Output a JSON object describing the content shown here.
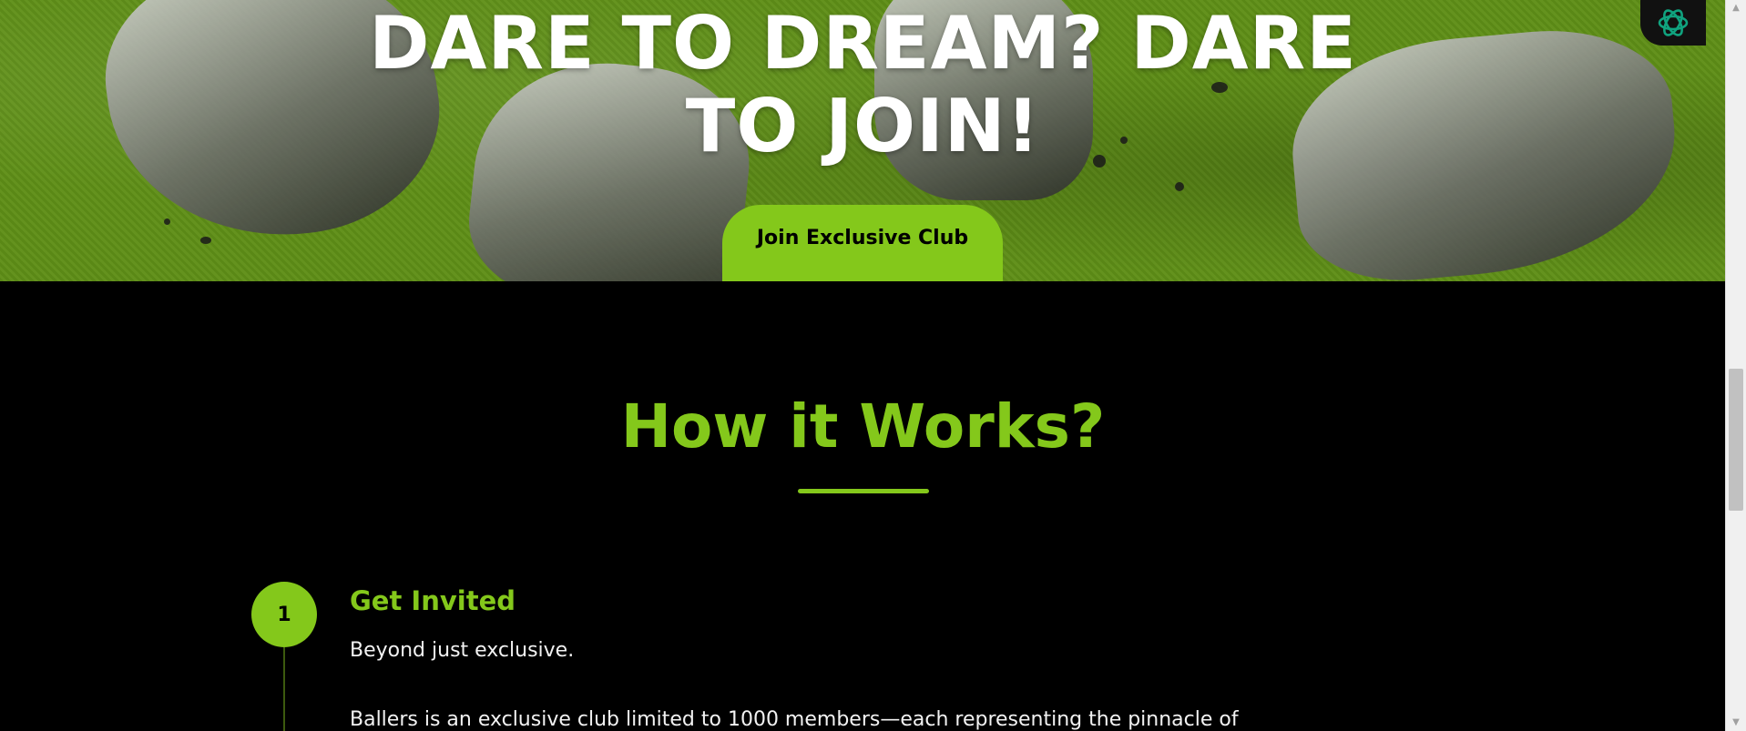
{
  "hero": {
    "title_line1": "DARE TO DREAM? DARE",
    "title_line2": "TO JOIN!",
    "cta_label": "Join Exclusive Club",
    "background_color": "#5f8f17",
    "accent_color": "#84c81b"
  },
  "chat_widget": {
    "icon": "openai-logo-icon",
    "color": "#10a37f"
  },
  "how_it_works": {
    "title": "How it Works?",
    "steps": [
      {
        "number": "1",
        "title": "Get Invited",
        "subtitle": "Beyond just exclusive.",
        "body": "Ballers is an exclusive club limited to 1000 members—each representing the pinnacle of"
      }
    ]
  },
  "scrollbar": {
    "up_arrow": "▲",
    "down_arrow": "▼"
  }
}
